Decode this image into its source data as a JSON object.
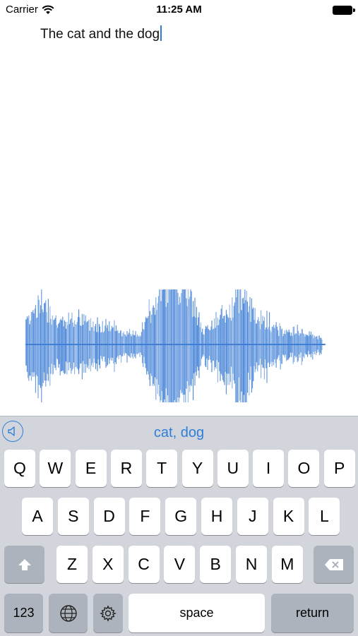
{
  "status_bar": {
    "carrier": "Carrier",
    "time": "11:25 AM"
  },
  "editor": {
    "text": "The cat and the dog"
  },
  "keyboard": {
    "suggestion": "cat, dog",
    "row1": [
      "Q",
      "W",
      "E",
      "R",
      "T",
      "Y",
      "U",
      "I",
      "O",
      "P"
    ],
    "row2": [
      "A",
      "S",
      "D",
      "F",
      "G",
      "H",
      "J",
      "K",
      "L"
    ],
    "row3": [
      "Z",
      "X",
      "C",
      "V",
      "B",
      "N",
      "M"
    ],
    "numbers_label": "123",
    "space_label": "space",
    "return_label": "return"
  },
  "colors": {
    "accent": "#2f7fd9",
    "waveform": "#3f7fd6",
    "keyboard_bg": "#d2d5db",
    "dark_key": "#adb3bc"
  }
}
